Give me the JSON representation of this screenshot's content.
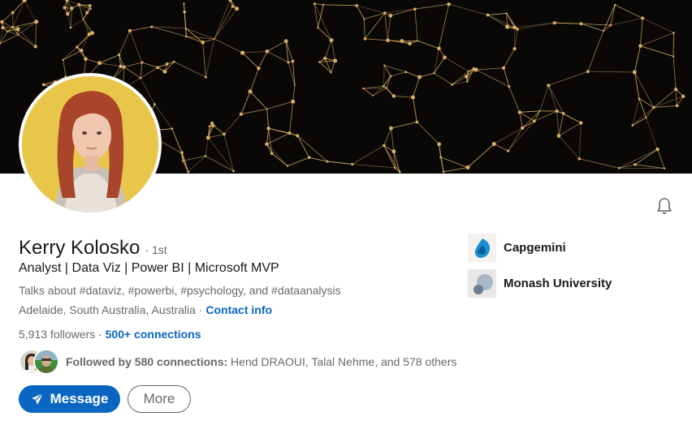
{
  "profile": {
    "name": "Kerry Kolosko",
    "degree": "· 1st",
    "headline": "Analyst | Data Viz | Power BI | Microsoft MVP",
    "talks_about": "Talks about #dataviz, #powerbi, #psychology, and #dataanalysis",
    "location": "Adelaide, South Australia, Australia",
    "location_separator": " · ",
    "contact_info": "Contact info",
    "followers": "5,913 followers",
    "connections_separator": " · ",
    "connections": "500+ connections",
    "followed_by_bold": "Followed by 580 connections:",
    "followed_by_names": " Hend DRAOUI, Talal Nehme, and 578 others"
  },
  "actions": {
    "message_label": "Message",
    "more_label": "More"
  },
  "organizations": [
    {
      "name": "Capgemini",
      "icon": "capgemini-logo"
    },
    {
      "name": "Monash University",
      "icon": "monash-logo"
    }
  ],
  "icons": {
    "bell": "bell-icon",
    "send": "paper-plane-icon"
  },
  "colors": {
    "accent": "#0a66c2",
    "banner_bg": "#0a0806",
    "banner_network": "#d8ae6a",
    "avatar_bg": "#e8c64a"
  }
}
